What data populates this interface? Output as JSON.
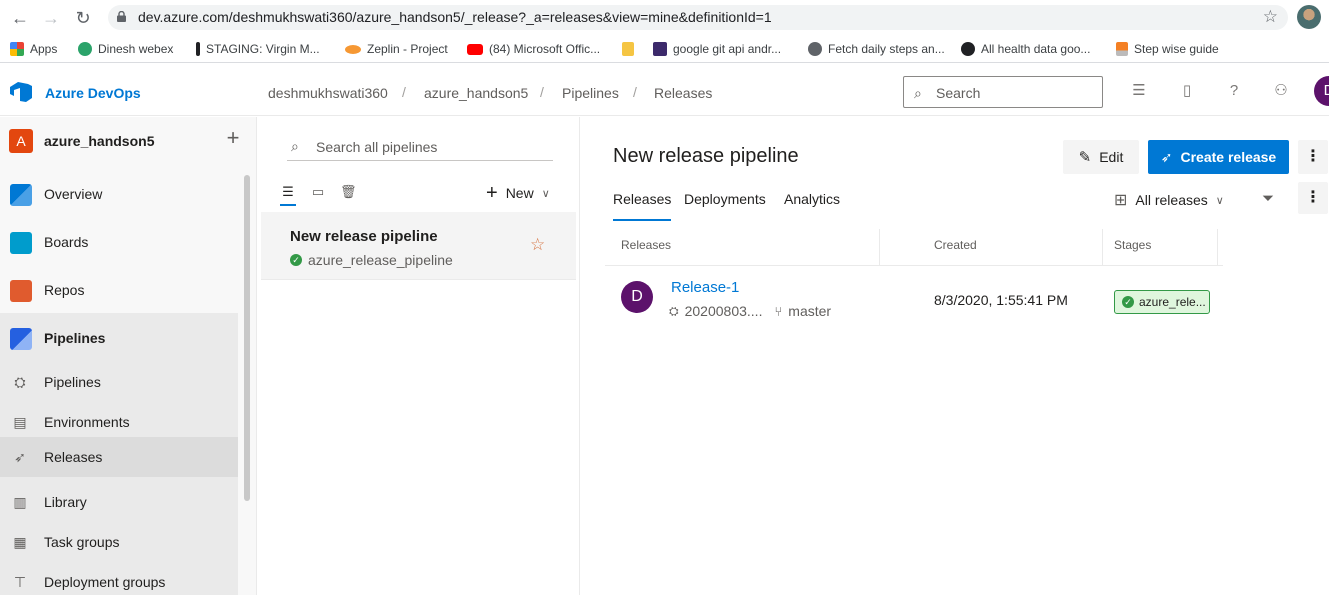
{
  "browser": {
    "url": "dev.azure.com/deshmukhswati360/azure_handson5/_release?_a=releases&view=mine&definitionId=1",
    "bookmarks": [
      {
        "label": "Apps",
        "color": "#ea4335"
      },
      {
        "label": "Dinesh webex",
        "color": "#2ba36a"
      },
      {
        "label": "STAGING: Virgin M...",
        "color": "#202124"
      },
      {
        "label": "Zeplin - Project",
        "color": "#f69833"
      },
      {
        "label": "(84) Microsoft Offic...",
        "color": "#ff0000"
      },
      {
        "label": "",
        "color": "#f5c543"
      },
      {
        "label": "google git api andr...",
        "color": "#3c2a6b"
      },
      {
        "label": "Fetch daily steps an...",
        "color": "#5f6368"
      },
      {
        "label": "All health data goo...",
        "color": "#202124"
      },
      {
        "label": "Step wise guide",
        "color": "#f48024"
      }
    ]
  },
  "header": {
    "brand": "Azure DevOps",
    "breadcrumbs": [
      "deshmukhswati360",
      "azure_handson5",
      "Pipelines",
      "Releases"
    ],
    "search_placeholder": "Search",
    "user_initial": "D"
  },
  "sidebar": {
    "project_initial": "A",
    "project_name": "azure_handson5",
    "items": [
      {
        "label": "Overview",
        "icon": "overview-icon",
        "color": "#0078d4"
      },
      {
        "label": "Boards",
        "icon": "boards-icon",
        "color": "#009ccc"
      },
      {
        "label": "Repos",
        "icon": "repos-icon",
        "color": "#e05b2e"
      },
      {
        "label": "Pipelines",
        "icon": "pipelines-icon",
        "color": "#2560e0"
      }
    ],
    "sub_items": [
      {
        "label": "Pipelines",
        "icon": "pipelines-sub-icon",
        "glyph": "⛭"
      },
      {
        "label": "Environments",
        "icon": "environments-icon",
        "glyph": "▤"
      },
      {
        "label": "Releases",
        "icon": "releases-icon",
        "glyph": "➶"
      },
      {
        "label": "Library",
        "icon": "library-icon",
        "glyph": "▥"
      },
      {
        "label": "Task groups",
        "icon": "task-groups-icon",
        "glyph": "▦"
      },
      {
        "label": "Deployment groups",
        "icon": "deployment-groups-icon",
        "glyph": "⊤"
      }
    ]
  },
  "pipelines_list": {
    "search_placeholder": "Search all pipelines",
    "new_label": "New",
    "items": [
      {
        "name": "New release pipeline",
        "last_release": "azure_release_pipeline"
      }
    ]
  },
  "detail": {
    "title": "New release pipeline",
    "edit_label": "Edit",
    "create_label": "Create release",
    "tabs": [
      "Releases",
      "Deployments",
      "Analytics"
    ],
    "filter_label": "All releases",
    "columns": [
      "Releases",
      "Created",
      "Stages"
    ],
    "releases": [
      {
        "initial": "D",
        "name": "Release-1",
        "build": "20200803....",
        "branch": "master",
        "created": "8/3/2020, 1:55:41 PM",
        "stage": "azure_rele..."
      }
    ]
  },
  "colors": {
    "accent": "#0078d4",
    "success": "#339947",
    "avatar": "#5c126b",
    "project": "#e3470f"
  }
}
